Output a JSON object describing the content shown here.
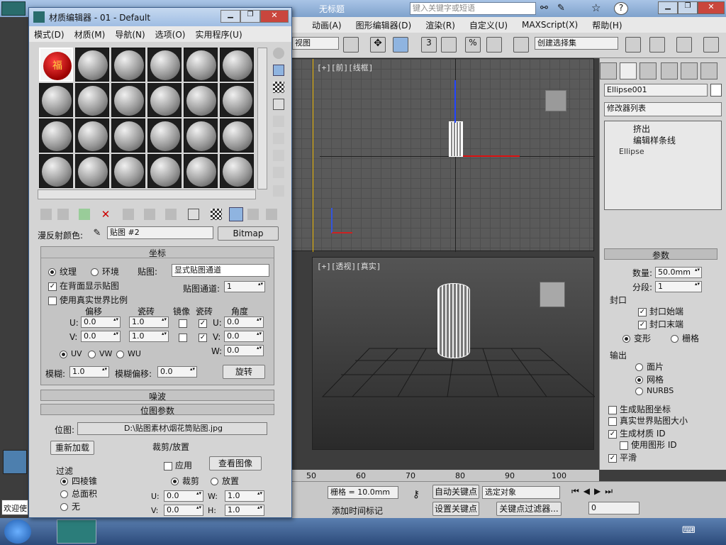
{
  "max": {
    "title": "无标题",
    "search_placeholder": "键入关键字或短语",
    "menu": [
      "动画(A)",
      "图形编辑器(D)",
      "渲染(R)",
      "自定义(U)",
      "MAXScript(X)",
      "帮助(H)"
    ],
    "view_dropdown": "视图",
    "selection_set": "创建选择集",
    "front_viewport_label": "[+][前][线框]",
    "persp_viewport_label": "[+][透视][真实]",
    "ruler_ticks": [
      "50",
      "60",
      "70",
      "80",
      "90",
      "100"
    ],
    "object_name": "Ellipse001",
    "modifier_list": "修改器列表",
    "modifier_stack": [
      "挤出",
      "编辑样条线",
      "Ellipse"
    ],
    "params_header": "参数",
    "amount_label": "数量:",
    "amount_value": "50.0mm",
    "segments_label": "分段:",
    "segments_value": "1",
    "cap_label": "封口",
    "cap_start": "封口始端",
    "cap_end": "封口末端",
    "morph": "变形",
    "grid": "栅格",
    "output_label": "输出",
    "patch": "面片",
    "mesh": "网格",
    "nurbs": "NURBS",
    "gen_mapping": "生成贴图坐标",
    "real_world": "真实世界贴图大小",
    "gen_mat_id": "生成材质 ID",
    "use_shape_id": "使用图形 ID",
    "smooth": "平滑",
    "grid_value": "栅格 = 10.0mm",
    "auto_key": "自动关键点",
    "set_key": "设置关键点",
    "selected_obj": "选定对象",
    "key_filter": "关键点过滤器...",
    "add_time_tag": "添加时间标记",
    "frame_value": "0",
    "welcome": "欢迎使"
  },
  "medit": {
    "title": "材质编辑器 - 01 - Default",
    "menu": [
      "模式(D)",
      "材质(M)",
      "导航(N)",
      "选项(O)",
      "实用程序(U)"
    ],
    "diffuse_label": "漫反射颜色:",
    "map_name": "贴图 #2",
    "map_type": "Bitmap",
    "coords_header": "坐标",
    "texture": "纹理",
    "environ": "环境",
    "mapping_label": "贴图:",
    "mapping_value": "显式贴图通道",
    "show_back": "在背面显示贴图",
    "map_channel_label": "贴图通道:",
    "map_channel_value": "1",
    "use_real_world": "使用真实世界比例",
    "col_offset": "偏移",
    "col_tiling": "瓷砖",
    "col_mirror": "镜像",
    "col_tile": "瓷砖",
    "col_angle": "角度",
    "u_label": "U:",
    "v_label": "V:",
    "w_label": "W:",
    "u_offset": "0.0",
    "v_offset": "0.0",
    "u_tiling": "1.0",
    "v_tiling": "1.0",
    "u_angle": "0.0",
    "v_angle": "0.0",
    "w_angle": "0.0",
    "uv": "UV",
    "vw": "VW",
    "wu": "WU",
    "blur_label": "模糊:",
    "blur_value": "1.0",
    "blur_offset_label": "模糊偏移:",
    "blur_offset_value": "0.0",
    "rotate": "旋转",
    "noise_header": "噪波",
    "bitmap_params_header": "位图参数",
    "bitmap_label": "位图:",
    "bitmap_path": "D:\\贴图素材\\烟花筒贴图.jpg",
    "reload": "重新加载",
    "crop_place": "裁剪/放置",
    "apply": "应用",
    "view_image": "查看图像",
    "crop": "裁剪",
    "place": "放置",
    "filter_label": "过滤",
    "pyramid": "四棱锥",
    "summed_area": "总面积",
    "none": "无",
    "crop_u": "0.0",
    "crop_v": "0.0",
    "crop_w": "1.0",
    "crop_h": "1.0",
    "crop_w_label": "W:",
    "crop_h_label": "H:",
    "fu_char": "福"
  }
}
